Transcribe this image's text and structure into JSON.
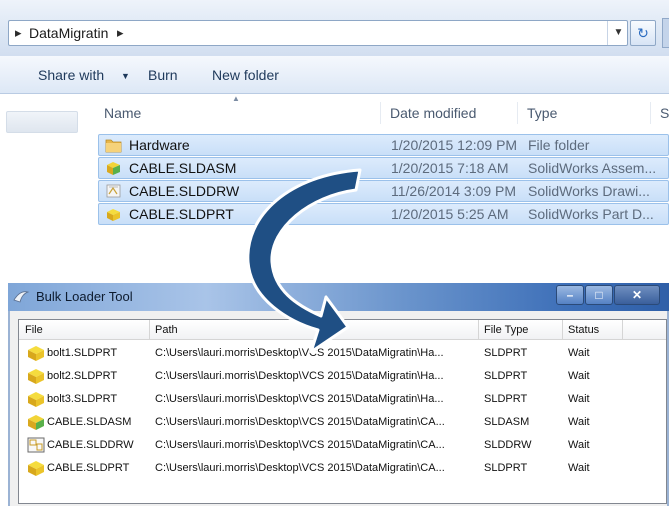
{
  "explorer": {
    "breadcrumb": "DataMigratin",
    "toolbar": {
      "share_label": "Share with",
      "burn_label": "Burn",
      "new_folder_label": "New folder"
    },
    "columns": {
      "name": "Name",
      "date": "Date modified",
      "type": "Type",
      "size": "S"
    },
    "files": [
      {
        "name": "Hardware",
        "date": "1/20/2015 12:09 PM",
        "type": "File folder",
        "icon": "folder-icon"
      },
      {
        "name": "CABLE.SLDASM",
        "date": "1/20/2015 7:18 AM",
        "type": "SolidWorks Assem...",
        "icon": "assembly-icon"
      },
      {
        "name": "CABLE.SLDDRW",
        "date": "11/26/2014 3:09 PM",
        "type": "SolidWorks Drawi...",
        "icon": "drawing-icon"
      },
      {
        "name": "CABLE.SLDPRT",
        "date": "1/20/2015 5:25 AM",
        "type": "SolidWorks Part D...",
        "icon": "part-icon"
      }
    ]
  },
  "bulk_loader": {
    "title": "Bulk Loader Tool",
    "columns": {
      "file": "File",
      "path": "Path",
      "file_type": "File Type",
      "status": "Status"
    },
    "rows": [
      {
        "file": "bolt1.SLDPRT",
        "path": "C:\\Users\\lauri.morris\\Desktop\\VCS 2015\\DataMigratin\\Ha...",
        "file_type": "SLDPRT",
        "status": "Wait",
        "icon": "part-icon"
      },
      {
        "file": "bolt2.SLDPRT",
        "path": "C:\\Users\\lauri.morris\\Desktop\\VCS 2015\\DataMigratin\\Ha...",
        "file_type": "SLDPRT",
        "status": "Wait",
        "icon": "part-icon"
      },
      {
        "file": "bolt3.SLDPRT",
        "path": "C:\\Users\\lauri.morris\\Desktop\\VCS 2015\\DataMigratin\\Ha...",
        "file_type": "SLDPRT",
        "status": "Wait",
        "icon": "part-icon"
      },
      {
        "file": "CABLE.SLDASM",
        "path": "C:\\Users\\lauri.morris\\Desktop\\VCS 2015\\DataMigratin\\CA...",
        "file_type": "SLDASM",
        "status": "Wait",
        "icon": "assembly-icon"
      },
      {
        "file": "CABLE.SLDDRW",
        "path": "C:\\Users\\lauri.morris\\Desktop\\VCS 2015\\DataMigratin\\CA...",
        "file_type": "SLDDRW",
        "status": "Wait",
        "icon": "drawing-icon"
      },
      {
        "file": "CABLE.SLDPRT",
        "path": "C:\\Users\\lauri.morris\\Desktop\\VCS 2015\\DataMigratin\\CA...",
        "file_type": "SLDPRT",
        "status": "Wait",
        "icon": "part-icon"
      }
    ]
  },
  "colors": {
    "selection_fill": "#cde2fa",
    "selection_border": "#9bc1ea",
    "arrow": "#1f4f84",
    "titlebar": "#3d6fb8"
  }
}
